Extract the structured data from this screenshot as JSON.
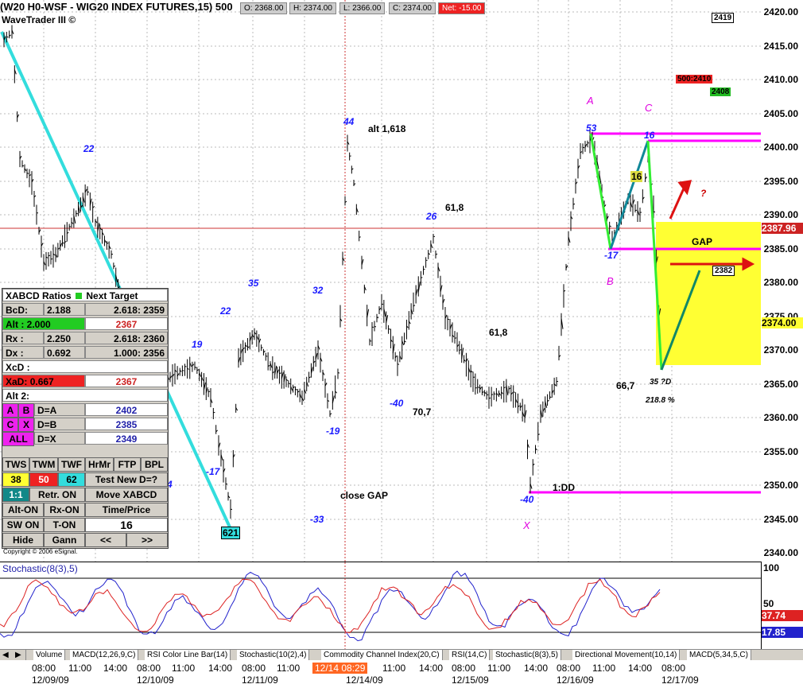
{
  "header": {
    "symbol_title": "(W20 H0-WSF - WIG20 INDEX FUTURES,15) 500",
    "subtitle": "WaveTrader III ©",
    "open": "O: 2368.00",
    "high": "H: 2374.00",
    "low": "L: 2366.00",
    "close": "C: 2374.00",
    "net": "Net: -15.00"
  },
  "price_axis": {
    "ticks": [
      "2420.00",
      "2415.00",
      "2410.00",
      "2405.00",
      "2400.00",
      "2395.00",
      "2390.00",
      "2385.00",
      "2380.00",
      "2375.00",
      "2370.00",
      "2365.00",
      "2360.00",
      "2355.00",
      "2350.00",
      "2345.00",
      "2340.00"
    ],
    "current_price": "2387.96",
    "last_price": "2374.00"
  },
  "chart_labels": {
    "box_2419": "2419",
    "box_2408": "2408",
    "box_500": "500:2410",
    "box_2382": "2382",
    "alt": "alt 1,618",
    "fib_618a": "61,8",
    "fib_618b": "61,8",
    "fib_707": "70,7",
    "fib_667": "66,7",
    "gap": "GAP",
    "close_gap": "close GAP",
    "dd": "1:DD",
    "pct": "218.8 %",
    "d35": "35 ?D",
    "question": "?",
    "pt_A": "A",
    "pt_B": "B",
    "pt_C": "C",
    "pt_X": "X",
    "c22a": "22",
    "c22b": "22",
    "c19": "19",
    "c35": "35",
    "c32": "32",
    "c44": "44",
    "c26": "26",
    "c53": "53",
    "c16": "16",
    "c16box": "16",
    "c_17a": "-17",
    "c_17b": "-17",
    "c_33": "-33",
    "c_19": "-19",
    "c_40a": "-40",
    "c_40b": "-40",
    "c4": "4",
    "c621": "621"
  },
  "panel": {
    "title": "XABCD Ratios",
    "next_target": "Next Target",
    "bcd_label": "BcD:",
    "bcd_val": "2.188",
    "bcd_tgt": "2.618: 2359",
    "alt_label": "Alt  :",
    "alt_val": "2.000",
    "alt_tgt": "2367",
    "rx_label": "Rx  :",
    "rx_val": "2.250",
    "rx_tgt": "2.618: 2360",
    "dx_label": "Dx  :",
    "dx_val": "0.692",
    "dx_tgt": "1.000: 2356",
    "xcd_label": "XcD :",
    "xad_label": "XaD:",
    "xad_val": "0.667",
    "xad_tgt": "2367",
    "alt2_label": "Alt 2:",
    "ab": "A",
    "bb": "B",
    "da": "D=A",
    "da_val": "2402",
    "cb": "C",
    "xb": "X",
    "db": "D=B",
    "db_val": "2385",
    "all": "ALL",
    "dx": "D=X",
    "dx2_val": "2349",
    "btn_tws": "TWS",
    "btn_twm": "TWM",
    "btn_twf": "TWF",
    "btn_hrmr": "HrMr",
    "btn_ftp": "FTP",
    "btn_bpl": "BPL",
    "n38": "38",
    "n50": "50",
    "n62": "62",
    "test_new": "Test New D=?",
    "ratio_11": "1:1",
    "retr_on": "Retr. ON",
    "move_xabcd": "Move XABCD",
    "alt_on": "Alt-ON",
    "rx_on": "Rx-ON",
    "time_price": "Time/Price",
    "sw_on": "SW ON",
    "t_on": "T-ON",
    "n16": "16",
    "hide": "Hide",
    "gann": "Gann",
    "prev": "<<",
    "next": ">>",
    "copyright": "Copyright © 2006 eSignal."
  },
  "stoch": {
    "title": "Stochastic(8(3),5)",
    "t100": "100",
    "t50": "50",
    "v1": "37.74",
    "v2": "17.85"
  },
  "tabs": [
    "Volume",
    "MACD(12,26,9,C)",
    "RSI Color Line Bar(14)",
    "Stochastic(10(2),4)",
    "Commodity Channel Index(20,C)",
    "RSI(14,C)",
    "Stochastic(8(3),5)",
    "Directional Movement(10,14)",
    "MACD(5,34,5,C)"
  ],
  "time_axis": {
    "times": [
      "08:00",
      "11:00",
      "14:00",
      "08:00",
      "11:00",
      "14:00",
      "08:00",
      "11:00",
      "14:00",
      "08:29",
      "11:00",
      "14:00",
      "08:00",
      "11:00",
      "14:00",
      "08:00",
      "11:00",
      "14:00",
      "08:00"
    ],
    "dates": [
      "12/09/09",
      "12/10/09",
      "12/11/09",
      "12/14/09",
      "12/15/09",
      "12/16/09",
      "12/17/09"
    ],
    "highlight": "12/14  08:29"
  },
  "colors": {
    "cyan_trend": "#33dddd",
    "magenta_lines": "#ff00ff",
    "gap_zone": "#ffff33",
    "green_leg": "#33ee33",
    "teal_leg": "#118866"
  }
}
